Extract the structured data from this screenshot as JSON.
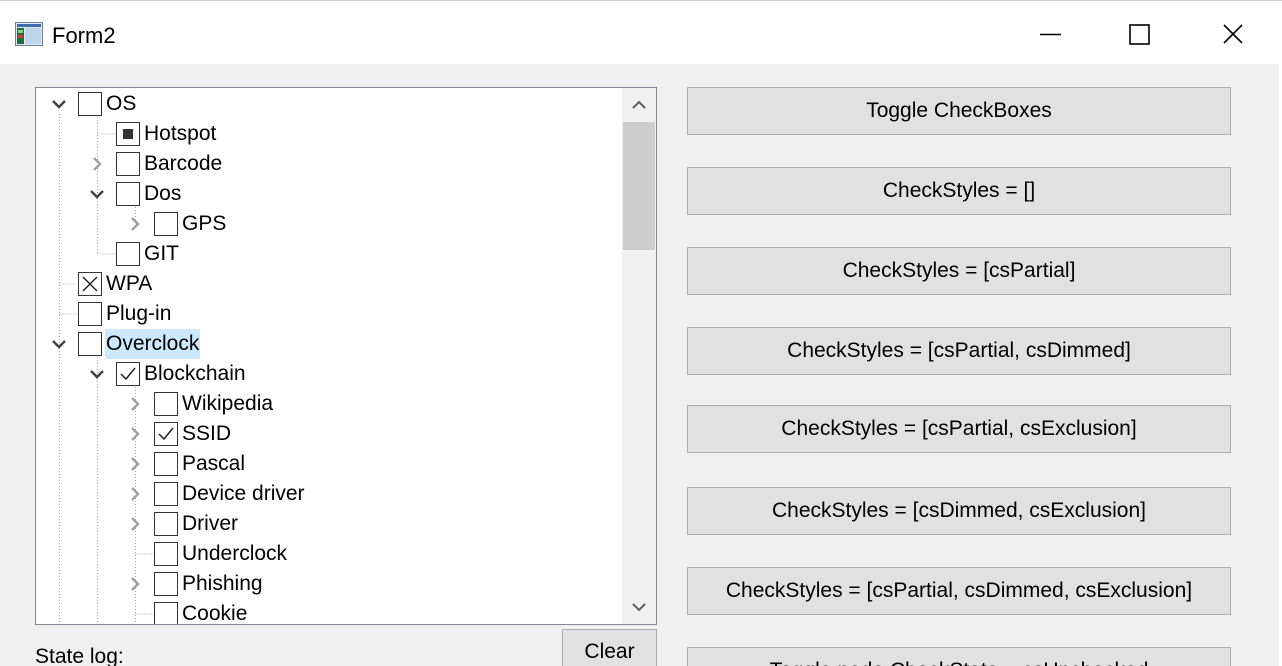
{
  "window": {
    "title": "Form2",
    "controls": [
      "minimize-icon",
      "maximize-icon",
      "close-icon"
    ]
  },
  "tree": {
    "nodes": [
      {
        "label": "OS",
        "expander": "expanded",
        "check": "unchecked"
      },
      {
        "label": "Hotspot",
        "expander": "none",
        "check": "partial"
      },
      {
        "label": "Barcode",
        "expander": "collapsed",
        "check": "unchecked"
      },
      {
        "label": "Dos",
        "expander": "expanded",
        "check": "unchecked"
      },
      {
        "label": "GPS",
        "expander": "collapsed",
        "check": "unchecked"
      },
      {
        "label": "GIT",
        "expander": "none",
        "check": "unchecked"
      },
      {
        "label": "WPA",
        "expander": "none",
        "check": "excluded"
      },
      {
        "label": "Plug-in",
        "expander": "none",
        "check": "unchecked"
      },
      {
        "label": "Overclock",
        "expander": "expanded",
        "check": "unchecked",
        "selected": true
      },
      {
        "label": "Blockchain",
        "expander": "expanded",
        "check": "checked"
      },
      {
        "label": "Wikipedia",
        "expander": "collapsed",
        "check": "unchecked"
      },
      {
        "label": "SSID",
        "expander": "collapsed",
        "check": "checked"
      },
      {
        "label": "Pascal",
        "expander": "collapsed",
        "check": "unchecked"
      },
      {
        "label": "Device driver",
        "expander": "collapsed",
        "check": "unchecked"
      },
      {
        "label": "Driver",
        "expander": "collapsed",
        "check": "unchecked"
      },
      {
        "label": "Underclock",
        "expander": "none",
        "check": "unchecked"
      },
      {
        "label": "Phishing",
        "expander": "collapsed",
        "check": "unchecked"
      },
      {
        "label": "Cookie",
        "expander": "none",
        "check": "unchecked"
      }
    ]
  },
  "buttons": [
    {
      "label": "Toggle CheckBoxes"
    },
    {
      "label": "CheckStyles = []"
    },
    {
      "label": "CheckStyles = [csPartial]"
    },
    {
      "label": "CheckStyles = [csPartial, csDimmed]"
    },
    {
      "label": "CheckStyles = [csPartial, csExclusion]"
    },
    {
      "label": "CheckStyles = [csDimmed, csExclusion]"
    },
    {
      "label": "CheckStyles = [csPartial, csDimmed, csExclusion]"
    },
    {
      "label": "Toggle node.CheckState = csUnchecked"
    }
  ],
  "log": {
    "label": "State log:",
    "clear_label": "Clear"
  },
  "colors": {
    "selection": "#cce8ff",
    "button_face": "#e1e1e1",
    "window_bg": "#f0f0f0"
  }
}
